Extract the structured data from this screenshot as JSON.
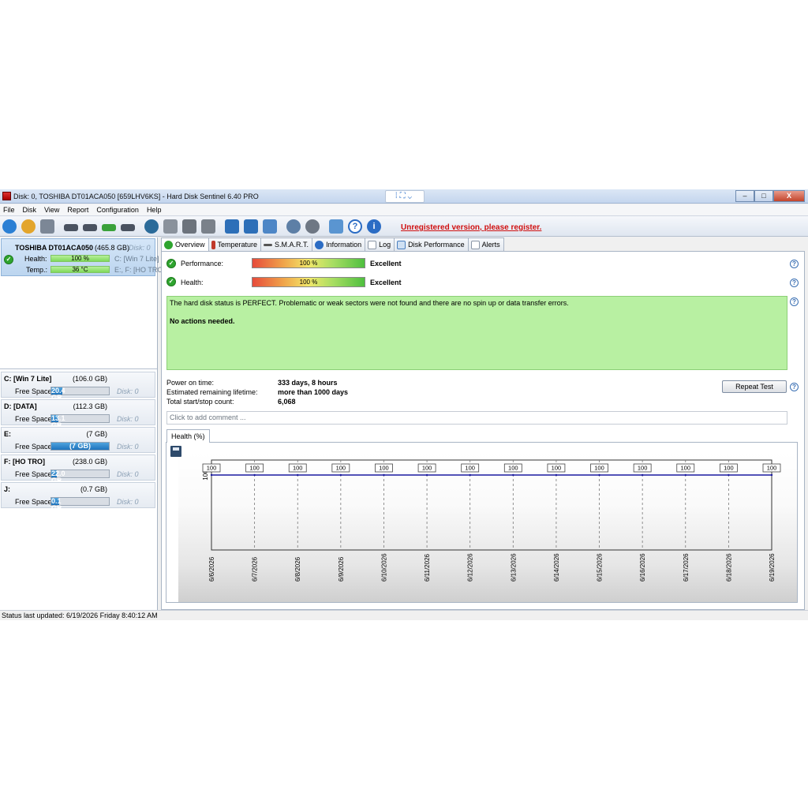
{
  "window": {
    "title": "Disk: 0, TOSHIBA DT01ACA050 [659LHV6KS]  -  Hard Disk Sentinel 6.40 PRO",
    "controls": {
      "minimize": "–",
      "maximize": "□",
      "close": "X"
    }
  },
  "menu": [
    "File",
    "Disk",
    "View",
    "Report",
    "Configuration",
    "Help"
  ],
  "toolbar": {
    "register_text": "Unregistered version, please register.",
    "icons": [
      "refresh-icon",
      "refresh-all-icon",
      "disk-list-icon",
      "disk-icon",
      "disk-remove-icon",
      "disk-check-icon",
      "disk-tool-icon",
      "surface-test-icon",
      "eject-icon",
      "tools-icon",
      "disk-settings-icon",
      "notes-icon",
      "email-icon",
      "cloud-icon",
      "settings-icon",
      "gear-icon",
      "camera-icon",
      "help-icon",
      "info-icon"
    ],
    "accent": "#2b6cc4"
  },
  "disk_card": {
    "name": "TOSHIBA DT01ACA050",
    "size": "(465.8 GB)",
    "index": "Disk: 0",
    "health_label": "Health:",
    "health_value": "100 %",
    "temp_label": "Temp.:",
    "temp_value": "36 °C",
    "partitions_1": "C: [Win 7 Lite]",
    "partitions_2": "E:, F: [HO TRO]"
  },
  "volumes": [
    {
      "name": "C: [Win 7 Lite]",
      "size": "(106.0 GB)",
      "free_label": "Free Space",
      "free": "20.4 GB",
      "free_fraction": 0.19,
      "disk": "Disk: 0"
    },
    {
      "name": "D: [DATA]",
      "size": "(112.3 GB)",
      "free_label": "Free Space",
      "free": "13.1 GB",
      "free_fraction": 0.12,
      "disk": "Disk: 0"
    },
    {
      "name": "E:",
      "size": "(7 GB)",
      "free_label": "Free Space",
      "free": "(7 GB)",
      "free_fraction": 1.0,
      "disk": "Disk: 0"
    },
    {
      "name": "F: [HO TRO]",
      "size": "(238.0 GB)",
      "free_label": "Free Space",
      "free": "22.0 GB",
      "free_fraction": 0.09,
      "disk": "Disk: 0"
    },
    {
      "name": "J:",
      "size": "(0.7 GB)",
      "free_label": "Free Space",
      "free": "0.1 GB",
      "free_fraction": 0.14,
      "disk": "Disk: 0"
    }
  ],
  "tabs": [
    {
      "label": "Overview",
      "icon": "check-icon",
      "color": "#2fa52f",
      "active": true
    },
    {
      "label": "Temperature",
      "icon": "thermometer-icon",
      "color": "#c0392b"
    },
    {
      "label": "S.M.A.R.T.",
      "icon": "smart-icon",
      "color": "#555555"
    },
    {
      "label": "Information",
      "icon": "info-icon",
      "color": "#2b6cc4"
    },
    {
      "label": "Log",
      "icon": "log-icon",
      "color": "#8a96a6"
    },
    {
      "label": "Disk Performance",
      "icon": "performance-icon",
      "color": "#4a7fc0"
    },
    {
      "label": "Alerts",
      "icon": "alerts-icon",
      "color": "#8a96a6"
    }
  ],
  "overview": {
    "performance_label": "Performance:",
    "performance_value": "100 %",
    "performance_rating": "Excellent",
    "health_label": "Health:",
    "health_value": "100 %",
    "health_rating": "Excellent",
    "status_text": "The hard disk status is PERFECT. Problematic or weak sectors were not found and there are no spin up or data transfer errors.",
    "actions_text": "No actions needed.",
    "power_on_label": "Power on time:",
    "power_on_value": "333 days, 8 hours",
    "lifetime_label": "Estimated remaining lifetime:",
    "lifetime_value": "more than 1000 days",
    "startstop_label": "Total start/stop count:",
    "startstop_value": "6,068",
    "repeat_test": "Repeat Test",
    "comment_placeholder": "Click to add comment ...",
    "chart_tab": "Health (%)",
    "status_color": "#b8f0a2"
  },
  "chart_data": {
    "type": "line",
    "x": [
      "6/6/2026",
      "6/7/2026",
      "6/8/2026",
      "6/9/2026",
      "6/10/2026",
      "6/11/2026",
      "6/12/2026",
      "6/13/2026",
      "6/14/2026",
      "6/15/2026",
      "6/16/2026",
      "6/17/2026",
      "6/18/2026",
      "6/19/2026"
    ],
    "values": [
      100,
      100,
      100,
      100,
      100,
      100,
      100,
      100,
      100,
      100,
      100,
      100,
      100,
      100
    ],
    "ytick": "100",
    "ylim": [
      0,
      120
    ],
    "line_color": "#1a1aa0",
    "grid": true
  },
  "statusbar": "Status last updated: 6/19/2026 Friday 8:40:12 AM"
}
